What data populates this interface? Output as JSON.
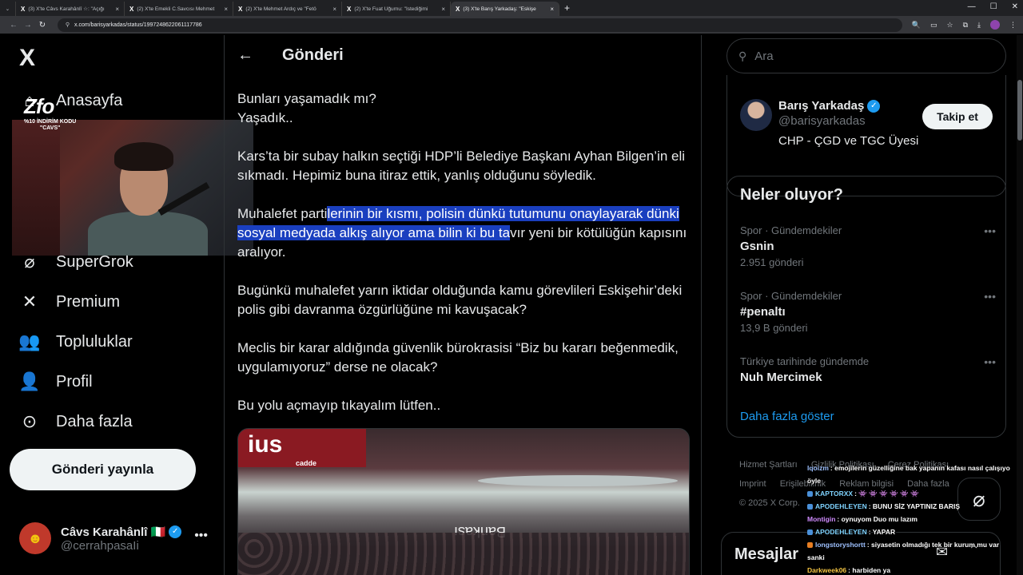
{
  "browser": {
    "tabs": [
      {
        "title": "(3) X'te Câvs Karahânlî ☆: \"Açığı"
      },
      {
        "title": "(2) X'te Emekli C.Savcısı Mehmet"
      },
      {
        "title": "(2) X'te Mehmet Ardıç ve \"Fetö"
      },
      {
        "title": "(2) X'te Fuat Uğurnu: \"İstediğimi"
      },
      {
        "title": "(3) X'te Barış Yarkadaş: \"Eskişe"
      }
    ],
    "new_tab": "+",
    "url": "x.com/barisyarkadas/status/1997248622061117786"
  },
  "nav": {
    "logo": "X",
    "items": [
      {
        "label": "Anasayfa",
        "icon": "home-icon"
      },
      {
        "label": "SuperGrok",
        "icon": "grok-icon"
      },
      {
        "label": "Premium",
        "icon": "x-premium-icon"
      },
      {
        "label": "Topluluklar",
        "icon": "communities-icon"
      },
      {
        "label": "Profil",
        "icon": "profile-icon"
      },
      {
        "label": "Daha fazla",
        "icon": "more-circle-icon"
      }
    ],
    "post_button": "Gönderi yayınla",
    "account": {
      "name": "Câvs Karahânlî 🇮🇹",
      "handle": "@cerrahpasaIi"
    }
  },
  "webcam": {
    "promo_big": "Zfo",
    "promo_line1": "%10 İNDİRİM KODU",
    "promo_line2": "\"CAVS\""
  },
  "main": {
    "title": "Gönderi",
    "paragraphs": {
      "p1a": "Bunları yaşamadık mı?",
      "p1b": "Yaşadık..",
      "p2": "Kars’ta bir subay halkın seçtiği HDP’li Belediye Başkanı Ayhan Bilgen’in eli sıkmadı. Hepimiz buna itiraz ettik, yanlış olduğunu söyledik.",
      "p3_pre": "Muhalefet parti",
      "p3_hl": "lerinin bir kısmı, polisin dünkü tutumunu onaylayarak dünki sosyal medyada alkış alıyor ama bilin ki bu ta",
      "p3_post": "vır yeni bir kötülüğün kapısını aralıyor.",
      "p4": "Bugünkü muhalefet yarın iktidar olduğunda kamu görevlileri Eskişehir’deki polis gibi davranma özgürlüğüne mi kavuşacak?",
      "p5": "Meclis bir karar aldığında güvenlik bürokrasisi “Biz bu kararı beğenmedik, uygulamıyoruz” derse ne olacak?",
      "p6": "Bu yolu açmayıp tıkayalım lütfen.."
    },
    "media": {
      "sign": "ius",
      "sign_sub": "cadde",
      "bank_text": "Bankası"
    }
  },
  "right": {
    "search_placeholder": "Ara",
    "profile": {
      "name": "Barış Yarkadaş",
      "handle": "@barisyarkadas",
      "bio": "CHP - ÇGD ve TGC Üyesi",
      "follow": "Takip et"
    },
    "trends_title": "Neler oluyor?",
    "trends": [
      {
        "meta": "Spor · Gündemdekiler",
        "name": "Gsnin",
        "count": "2.951 gönderi"
      },
      {
        "meta": "Spor · Gündemdekiler",
        "name": "#penaltı",
        "count": "13,9 B gönderi"
      },
      {
        "meta": "Türkiye tarihinde gündemde",
        "name": "Nuh Mercimek",
        "count": ""
      }
    ],
    "show_more": "Daha fazla göster",
    "footer": [
      "Hizmet Şartları",
      "Gizlilik Politikası",
      "Çerez Politikası",
      "Imprint",
      "Erişilebilirlik",
      "Reklam bilgisi",
      "Daha fazla",
      "© 2025 X Corp."
    ],
    "messages": "Mesajlar"
  },
  "chat": [
    {
      "user": "lqoizm",
      "text": ": emojilerin güzelliğine bak yapanın kafası nasıl çalışıyo öyle",
      "color": "#9ec1ff",
      "badge": ""
    },
    {
      "user": "KAPTORXX",
      "text": ": 👾 👾 👾 👾 👾 👾",
      "color": "#7fd3ff",
      "badge": "#4a90d9"
    },
    {
      "user": "APODEHLEYEN",
      "text": ": BUNU SİZ YAPTINIZ BARIŞ",
      "color": "#7fd3ff",
      "badge": "#4a90d9"
    },
    {
      "user": "Montigin",
      "text": ": oynuyom Duo mu lazım",
      "color": "#d08cff",
      "badge": ""
    },
    {
      "user": "APODEHLEYEN",
      "text": ": YAPAR",
      "color": "#7fd3ff",
      "badge": "#4a90d9"
    },
    {
      "user": "longstoryshortt",
      "text": ": siyasetin olmadığı tek bir kurum mu var sanki",
      "color": "#9ec1ff",
      "badge": "#e67e22"
    },
    {
      "user": "Darkweek06",
      "text": ": harbiden ya",
      "color": "#f5c542",
      "badge": ""
    }
  ]
}
